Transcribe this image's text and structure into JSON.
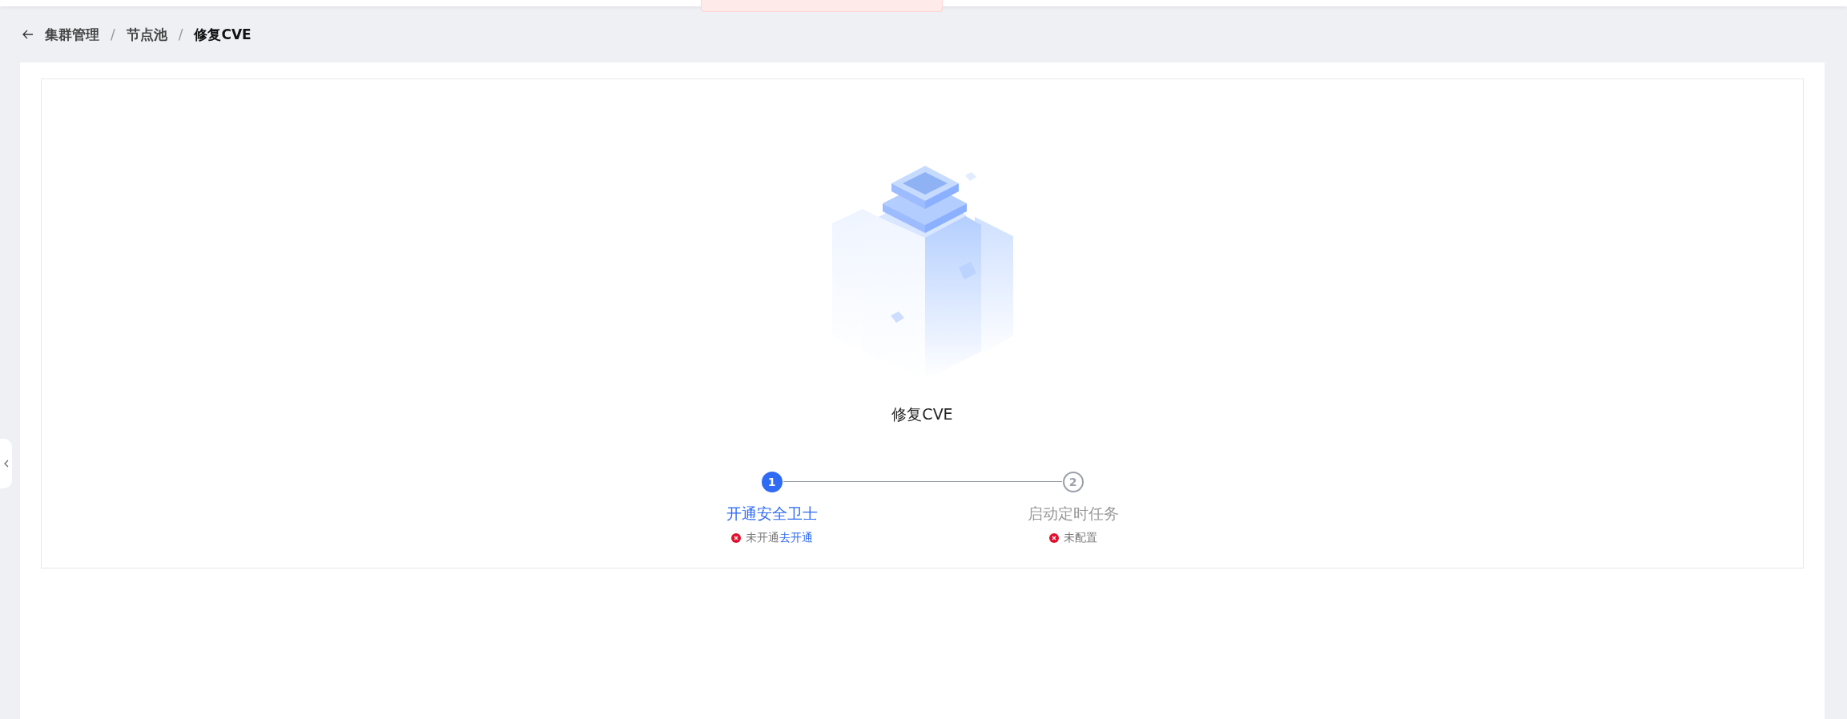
{
  "breadcrumb_separator": "/",
  "breadcrumb": [
    {
      "label": "集群管理",
      "current": false
    },
    {
      "label": "节点池",
      "current": false
    },
    {
      "label": "修复CVE",
      "current": true
    }
  ],
  "title": "修复CVE",
  "steps": [
    {
      "number": "1",
      "title": "开通安全卫士",
      "active": true,
      "status": "未开通",
      "link": "去开通"
    },
    {
      "number": "2",
      "title": "启动定时任务",
      "active": false,
      "status": "未配置"
    }
  ]
}
